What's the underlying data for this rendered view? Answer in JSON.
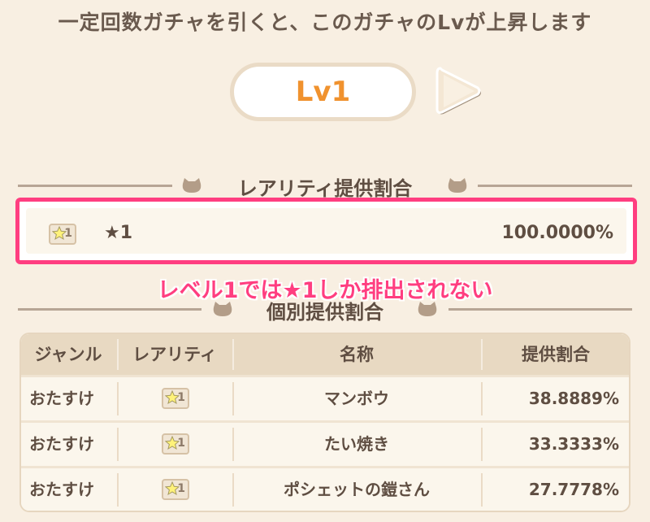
{
  "notice": "一定回数ガチャを引くと、このガチャのLvが上昇します",
  "level": {
    "label": "Lv1"
  },
  "rarity_section": {
    "title": "レアリティ提供割合",
    "rows": [
      {
        "icon_label": "1",
        "rarity": "★1",
        "rate": "100.0000%"
      }
    ]
  },
  "callout": "レベル1では★1しか排出されない",
  "individual_section": {
    "title": "個別提供割合",
    "columns": [
      "ジャンル",
      "レアリティ",
      "名称",
      "提供割合"
    ],
    "rows": [
      {
        "genre": "おたすけ",
        "rarity_icon_label": "1",
        "name": "マンボウ",
        "rate": "38.8889%"
      },
      {
        "genre": "おたすけ",
        "rarity_icon_label": "1",
        "name": "たい焼き",
        "rate": "33.3333%"
      },
      {
        "genre": "おたすけ",
        "rarity_icon_label": "1",
        "name": "ポシェットの鎧さん",
        "rate": "27.7778%"
      }
    ]
  },
  "icons": {
    "next": "next-arrow-icon",
    "star": "star-rarity-icon",
    "cat": "cat-head-icon"
  },
  "colors": {
    "accent": "#ff3e80",
    "level_text": "#f0922e",
    "background": "#f8efe2"
  }
}
